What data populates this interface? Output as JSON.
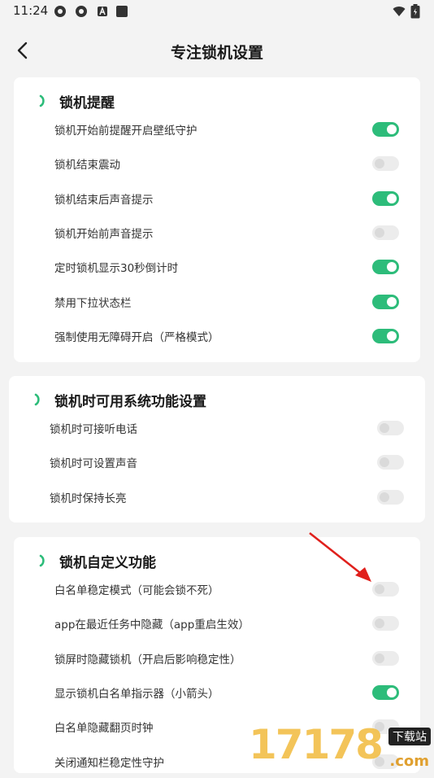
{
  "status_bar": {
    "time": "11:24"
  },
  "header": {
    "title": "专注锁机设置"
  },
  "accent": "#2dbc7a",
  "sections": [
    {
      "title": "锁机提醒",
      "items": [
        {
          "label": "锁机开始前提醒开启壁纸守护",
          "on": true
        },
        {
          "label": "锁机结束震动",
          "on": false
        },
        {
          "label": "锁机结束后声音提示",
          "on": true
        },
        {
          "label": "锁机开始前声音提示",
          "on": false
        },
        {
          "label": "定时锁机显示30秒倒计时",
          "on": true
        },
        {
          "label": "禁用下拉状态栏",
          "on": true
        },
        {
          "label": "强制使用无障碍开启（严格模式）",
          "on": true
        }
      ]
    },
    {
      "title": "锁机时可用系统功能设置",
      "items": [
        {
          "label": "锁机时可接听电话",
          "on": false
        },
        {
          "label": "锁机时可设置声音",
          "on": false
        },
        {
          "label": "锁机时保持长亮",
          "on": false
        }
      ]
    },
    {
      "title": "锁机自定义功能",
      "items": [
        {
          "label": "白名单稳定模式（可能会锁不死）",
          "on": false
        },
        {
          "label": "app在最近任务中隐藏（app重启生效）",
          "on": false
        },
        {
          "label": "锁屏时隐藏锁机（开启后影响稳定性）",
          "on": false
        },
        {
          "label": "显示锁机白名单指示器（小箭头）",
          "on": true
        },
        {
          "label": "白名单隐藏翻页时钟",
          "on": false
        },
        {
          "label": "关闭通知栏稳定性守护",
          "on": false
        }
      ]
    }
  ],
  "watermark": {
    "number": "17178",
    "badge": "下载站",
    "domain": ".com"
  }
}
